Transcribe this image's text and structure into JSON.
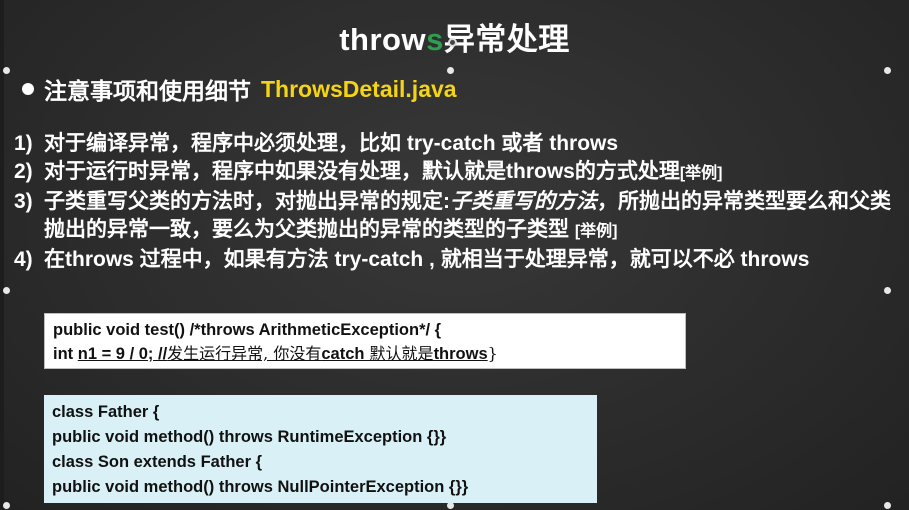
{
  "slide": {
    "title_part1": "throw",
    "title_accent": "s",
    "title_part2": "异常处理",
    "heading": "注意事项和使用细节",
    "heading_file": "ThrowsDetail.java",
    "items": [
      {
        "num": "1)",
        "text": "对于编译异常，程序中必须处理，比如 try-catch 或者 throws"
      },
      {
        "num": "2)",
        "text": "对于运行时异常，程序中如果没有处理，默认就是throws的方式处理",
        "note": "[举例]"
      },
      {
        "num": "3)",
        "text_a": "子类重写父类的方法时，对抛出异常的规定:",
        "text_italic": "子类重写的方法",
        "text_b": "，所抛出的异常类型要么和父类抛出的异常一致，要么为父类抛出的异常的类型的子类型 ",
        "note": "[举例]"
      },
      {
        "num": "4)",
        "text": "在throws 过程中，如果有方法 try-catch , 就相当于处理异常，就可以不必 throws"
      }
    ],
    "code1": {
      "line1": "public void test() /*throws ArithmeticException*/ {",
      "line2_code": "int ",
      "line2_underlined": "n1 = 9 / 0; //",
      "line2_comment_a": "发生运行异常, 你没有",
      "line2_comment_b": "catch",
      "line2_comment_c": " 默认就是",
      "line2_comment_d": "throws",
      "line2_end": "}"
    },
    "code2": {
      "lines": [
        "class Father {",
        "public void method() throws RuntimeException {}}",
        "class Son extends Father {",
        "public void method() throws NullPointerException {}}"
      ]
    },
    "colors": {
      "background": "#2c2c2c",
      "accent_green": "#2e9e4f",
      "file_yellow": "#f5d416",
      "code2_bg": "#d9f1f6"
    }
  }
}
